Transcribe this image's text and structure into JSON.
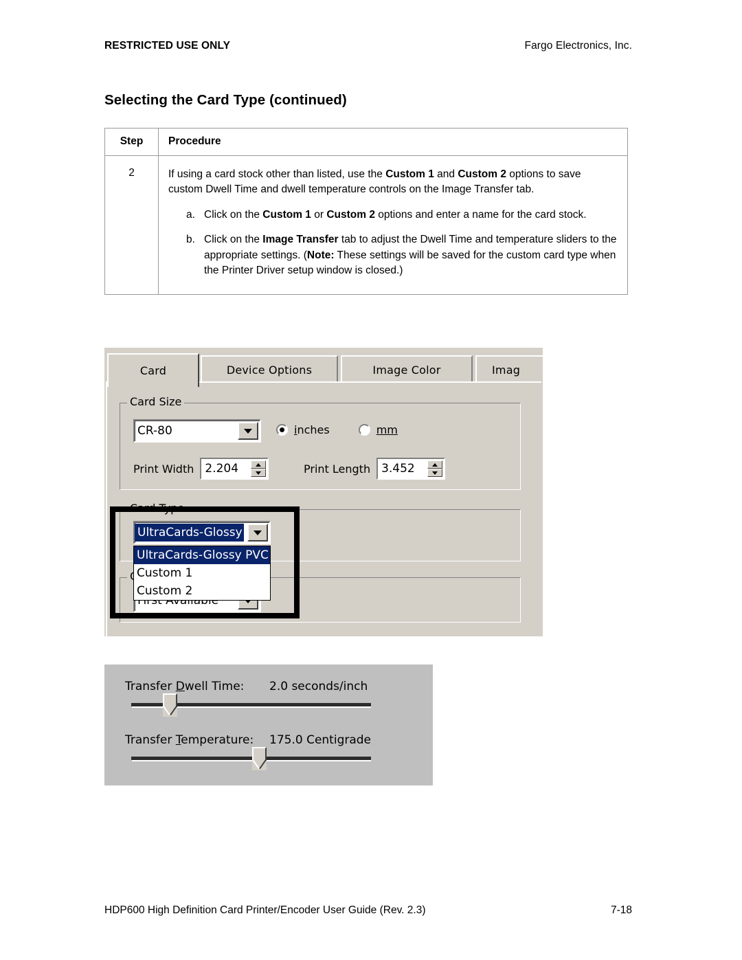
{
  "running_head": {
    "left": "RESTRICTED USE ONLY",
    "right": "Fargo Electronics, Inc."
  },
  "heading": "Selecting the Card Type (continued)",
  "table": {
    "headers": {
      "step": "Step",
      "procedure": "Procedure"
    },
    "rows": [
      {
        "step": "2",
        "intro": {
          "t1": "If using a card stock other than listed, use the ",
          "b1": "Custom 1",
          "t2": " and ",
          "b2": "Custom 2",
          "t3": " options to save custom Dwell Time and dwell temperature controls on the Image Transfer tab."
        },
        "substeps": [
          {
            "marker": "a.",
            "t1": "Click on the ",
            "b1": "Custom 1",
            "t2": " or ",
            "b2": "Custom 2",
            "t3": " options and enter a name for the card stock."
          },
          {
            "marker": "b.",
            "t1": "Click on the ",
            "b1": "Image Transfer",
            "t2": " tab to adjust the Dwell Time and temperature sliders to the appropriate settings. (",
            "b2": "Note:",
            "t3": "  These settings will be saved for the custom card type when the Printer Driver setup window is closed.)"
          }
        ]
      }
    ]
  },
  "dialog": {
    "tabs": [
      {
        "label": "Card",
        "active": true
      },
      {
        "label": "Device Options",
        "active": false
      },
      {
        "label": "Image Color",
        "active": false
      },
      {
        "label": "Imag",
        "active": false
      }
    ],
    "card_size": {
      "legend": "Card Size",
      "size_value": "CR-80",
      "units": [
        {
          "label": "inches",
          "selected": true
        },
        {
          "label": "mm",
          "selected": false
        }
      ],
      "print_width_label": "Print Width",
      "print_width_value": "2.204",
      "print_length_label": "Print Length",
      "print_length_value": "3.452"
    },
    "card_type": {
      "legend": "Card Type",
      "selected_value": "UltraCards-Glossy PVC",
      "options": [
        {
          "label": "UltraCards-Glossy PVC",
          "selected": true
        },
        {
          "label": "Custom 1",
          "selected": false
        },
        {
          "label": "Custom 2",
          "selected": false
        }
      ]
    },
    "card_hopper": {
      "legend": "Ca",
      "selected_value": "First Available"
    }
  },
  "sliders": {
    "dwell": {
      "label": "Transfer Dwell Time:",
      "value": "2.0  seconds/inch",
      "position_pct": 13
    },
    "temperature": {
      "label": "Transfer Temperature:",
      "value": "175.0  Centigrade",
      "position_pct": 50
    }
  },
  "footer": {
    "left": "HDP600 High Definition Card Printer/Encoder User Guide (Rev. 2.3)",
    "right": "7-18"
  },
  "colors": {
    "dialog_face": "#d4d0c8",
    "slider_face": "#bfbfbf",
    "selection_blue": "#0a246a"
  }
}
